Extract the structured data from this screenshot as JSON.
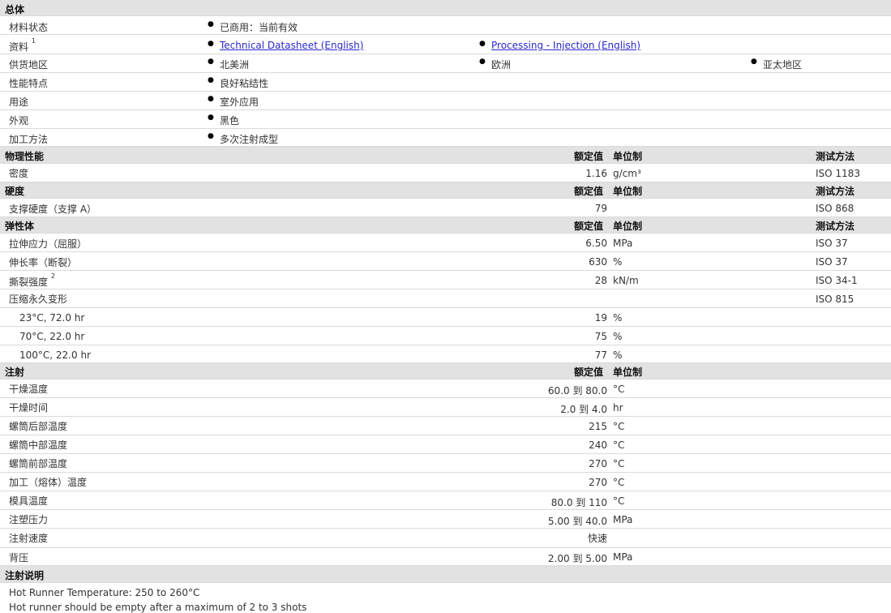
{
  "general": {
    "title": "总体",
    "material_status": {
      "label": "材料状态",
      "value": "已商用：当前有效"
    },
    "documents": {
      "label": "资料",
      "sup": "1",
      "link1": "Technical Datasheet (English)",
      "link2": "Processing - Injection (English)"
    },
    "supply": {
      "label": "供货地区",
      "v1": "北美洲",
      "v2": "欧洲",
      "v3": "亚太地区"
    },
    "features": {
      "label": "性能特点",
      "value": "良好粘结性"
    },
    "uses": {
      "label": "用途",
      "value": "室外应用"
    },
    "appearance": {
      "label": "外观",
      "value": "黑色"
    },
    "processing": {
      "label": "加工方法",
      "value": "多次注射成型"
    }
  },
  "headers": {
    "nominal": "额定值",
    "unit": "单位制",
    "method": "测试方法"
  },
  "physical": {
    "title": "物理性能",
    "density": {
      "label": "密度",
      "value": "1.16",
      "unit": "g/cm³",
      "method": "ISO 1183"
    }
  },
  "hardness": {
    "title": "硬度",
    "shore": {
      "label": "支撑硬度（支撑 A）",
      "value": "79",
      "method": "ISO 868"
    }
  },
  "elastomer": {
    "title": "弹性体",
    "tensile": {
      "label": "拉伸应力（屈服）",
      "value": "6.50",
      "unit": "MPa",
      "method": "ISO 37"
    },
    "elongation": {
      "label": "伸长率（断裂）",
      "value": "630",
      "unit": "%",
      "method": "ISO 37"
    },
    "tear": {
      "label": "撕裂强度",
      "sup": "2",
      "value": "28",
      "unit": "kN/m",
      "method": "ISO 34-1"
    },
    "compression": {
      "label": "压缩永久变形",
      "method": "ISO 815"
    },
    "cs1": {
      "label": "23°C, 72.0 hr",
      "value": "19",
      "unit": "%"
    },
    "cs2": {
      "label": "70°C, 22.0 hr",
      "value": "75",
      "unit": "%"
    },
    "cs3": {
      "label": "100°C, 22.0 hr",
      "value": "77",
      "unit": "%"
    }
  },
  "injection": {
    "title": "注射",
    "drying_temp": {
      "label": "干燥温度",
      "value": "60.0 到 80.0",
      "unit": "°C"
    },
    "drying_time": {
      "label": "干燥时间",
      "value": "2.0 到 4.0",
      "unit": "hr"
    },
    "rear_temp": {
      "label": "螺筒后部温度",
      "value": "215",
      "unit": "°C"
    },
    "middle_temp": {
      "label": "螺筒中部温度",
      "value": "240",
      "unit": "°C"
    },
    "front_temp": {
      "label": "螺筒前部温度",
      "value": "270",
      "unit": "°C"
    },
    "melt_temp": {
      "label": "加工（熔体）温度",
      "value": "270",
      "unit": "°C"
    },
    "mold_temp": {
      "label": "模具温度",
      "value": "80.0 到 110",
      "unit": "°C"
    },
    "inj_pressure": {
      "label": "注塑压力",
      "value": "5.00 到 40.0",
      "unit": "MPa"
    },
    "inj_speed": {
      "label": "注射速度",
      "value": "快速"
    },
    "back_pressure": {
      "label": "背压",
      "value": "2.00 到 5.00",
      "unit": "MPa"
    }
  },
  "notes": {
    "title": "注射说明",
    "line1": "Hot Runner Temperature: 250 to 260°C",
    "line2": "Hot runner should be empty after a maximum of 2 to 3 shots"
  }
}
